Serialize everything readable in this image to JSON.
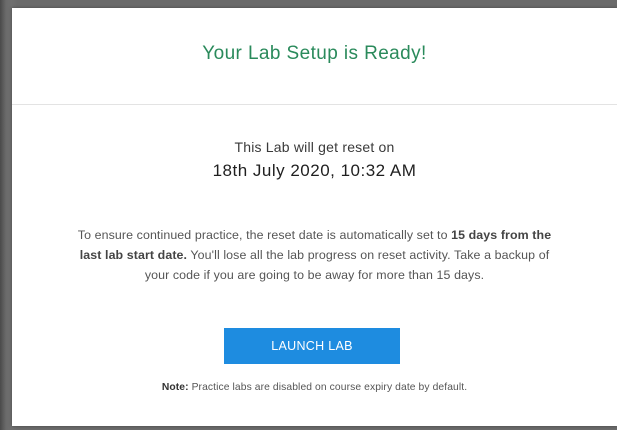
{
  "modal": {
    "title": "Your Lab Setup is Ready!",
    "reset_intro": "This Lab will get reset on",
    "reset_date": "18th July 2020, 10:32 AM",
    "info": {
      "part1": "To ensure continued practice, the reset date is automatically set to ",
      "bold": "15 days from the last lab start date.",
      "part2": " You'll lose all the lab progress on reset activity. Take a backup of your code if you are going to be away for more than 15 days."
    },
    "launch_button": "LAUNCH LAB",
    "note": {
      "label": "Note:",
      "text": " Practice labs are disabled on course expiry date by default."
    }
  },
  "colors": {
    "title": "#2a8a5b",
    "button": "#1e8ce0",
    "overlay": "#6b6b6b"
  }
}
